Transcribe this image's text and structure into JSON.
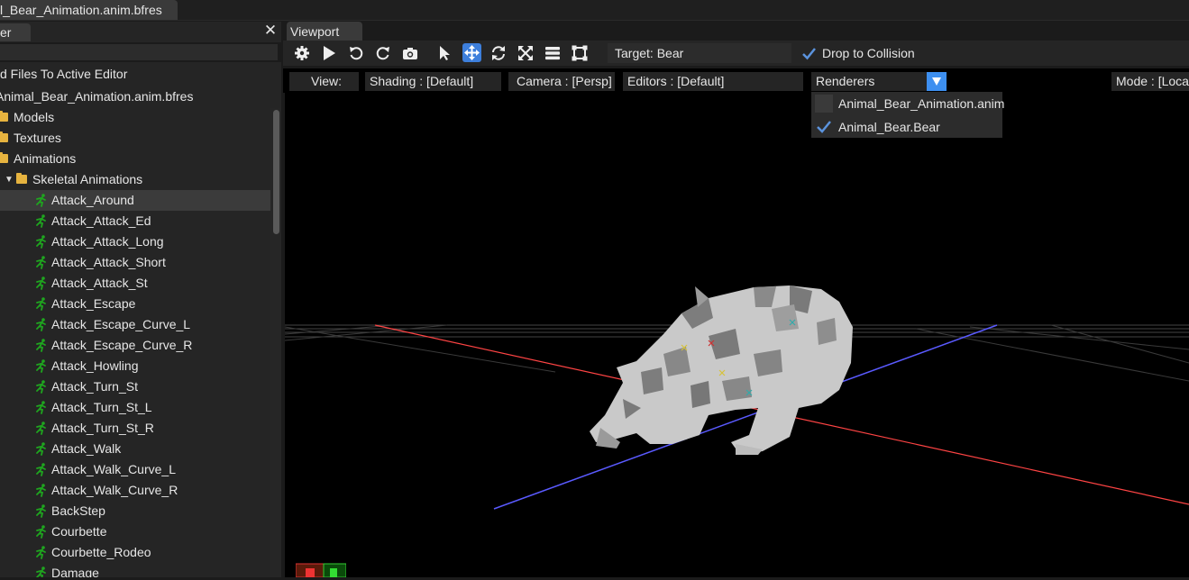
{
  "app": {
    "file_tab": "l_Bear_Animation.anim.bfres"
  },
  "left_panel": {
    "tab_label": "er",
    "add_files_label": "d Files To Active Editor",
    "search_value": "",
    "tree": [
      {
        "label": "Animal_Bear_Animation.anim.bfres",
        "indent": -5,
        "type": "root"
      },
      {
        "label": "Models",
        "indent": 15,
        "type": "folder"
      },
      {
        "label": "Textures",
        "indent": 15,
        "type": "folder"
      },
      {
        "label": "Animations",
        "indent": 15,
        "type": "folder"
      },
      {
        "label": "Skeletal Animations",
        "indent": 36,
        "type": "folder-open"
      },
      {
        "label": "Attack_Around",
        "indent": 57,
        "type": "anim",
        "selected": true
      },
      {
        "label": "Attack_Attack_Ed",
        "indent": 57,
        "type": "anim"
      },
      {
        "label": "Attack_Attack_Long",
        "indent": 57,
        "type": "anim"
      },
      {
        "label": "Attack_Attack_Short",
        "indent": 57,
        "type": "anim"
      },
      {
        "label": "Attack_Attack_St",
        "indent": 57,
        "type": "anim"
      },
      {
        "label": "Attack_Escape",
        "indent": 57,
        "type": "anim"
      },
      {
        "label": "Attack_Escape_Curve_L",
        "indent": 57,
        "type": "anim"
      },
      {
        "label": "Attack_Escape_Curve_R",
        "indent": 57,
        "type": "anim"
      },
      {
        "label": "Attack_Howling",
        "indent": 57,
        "type": "anim"
      },
      {
        "label": "Attack_Turn_St",
        "indent": 57,
        "type": "anim"
      },
      {
        "label": "Attack_Turn_St_L",
        "indent": 57,
        "type": "anim"
      },
      {
        "label": "Attack_Turn_St_R",
        "indent": 57,
        "type": "anim"
      },
      {
        "label": "Attack_Walk",
        "indent": 57,
        "type": "anim"
      },
      {
        "label": "Attack_Walk_Curve_L",
        "indent": 57,
        "type": "anim"
      },
      {
        "label": "Attack_Walk_Curve_R",
        "indent": 57,
        "type": "anim"
      },
      {
        "label": "BackStep",
        "indent": 57,
        "type": "anim"
      },
      {
        "label": "Courbette",
        "indent": 57,
        "type": "anim"
      },
      {
        "label": "Courbette_Rodeo",
        "indent": 57,
        "type": "anim"
      },
      {
        "label": "Damage",
        "indent": 57,
        "type": "anim"
      }
    ]
  },
  "viewport": {
    "tab_label": "Viewport",
    "target_label": "Target: Bear",
    "drop_collision_label": "Drop to Collision",
    "view_label": "View:",
    "shading_label": "Shading : [Default]",
    "camera_label": "Camera : [Persp]",
    "editors_label": "Editors : [Default]",
    "renderers_label": "Renderers",
    "mode_label": "Mode : [Local",
    "renderers_options": [
      {
        "label": "Animal_Bear_Animation.anim",
        "checked": false
      },
      {
        "label": "Animal_Bear.Bear",
        "checked": true
      }
    ],
    "axis_x_color": "#ff4444",
    "axis_z_color": "#5555ff",
    "accent_color": "#3d8ff0"
  },
  "icons": {
    "toolbar": [
      "gear-icon",
      "play-icon",
      "undo-icon",
      "redo-icon",
      "camera-icon",
      "select-arrow-icon",
      "move-icon",
      "rotate-icon",
      "scale-icon",
      "layers-icon",
      "transform-box-icon"
    ]
  }
}
